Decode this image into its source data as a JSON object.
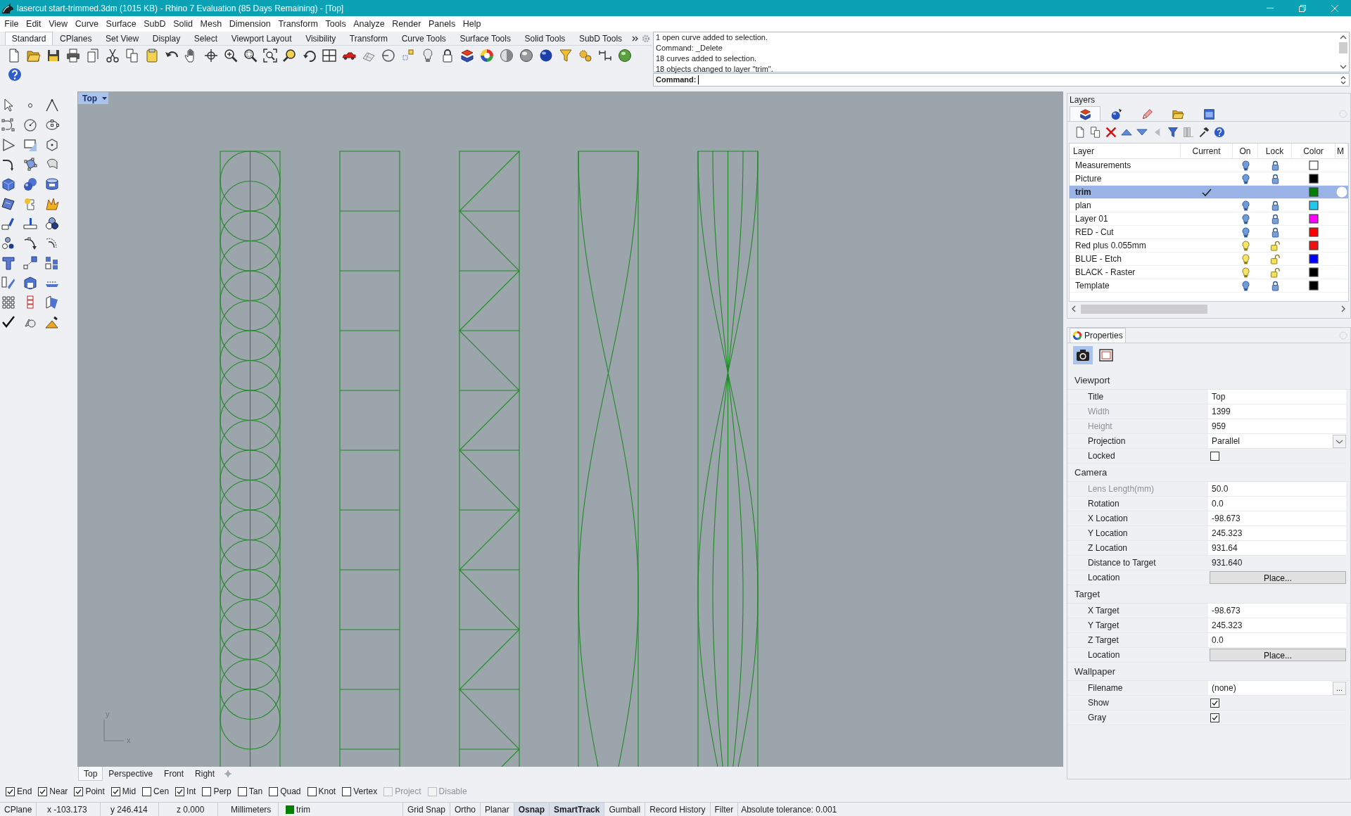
{
  "window": {
    "title": "lasercut start-trimmed.3dm (1015 KB) - Rhino 7 Evaluation (85 Days Remaining) - [Top]"
  },
  "menu": [
    "File",
    "Edit",
    "View",
    "Curve",
    "Surface",
    "SubD",
    "Solid",
    "Mesh",
    "Dimension",
    "Transform",
    "Tools",
    "Analyze",
    "Render",
    "Panels",
    "Help"
  ],
  "toolbar_tabs": [
    {
      "label": "Standard",
      "selected": true
    },
    {
      "label": "CPlanes",
      "selected": false
    },
    {
      "label": "Set View",
      "selected": false
    },
    {
      "label": "Display",
      "selected": false
    },
    {
      "label": "Select",
      "selected": false
    },
    {
      "label": "Viewport Layout",
      "selected": false
    },
    {
      "label": "Visibility",
      "selected": false
    },
    {
      "label": "Transform",
      "selected": false
    },
    {
      "label": "Curve Tools",
      "selected": false
    },
    {
      "label": "Surface Tools",
      "selected": false
    },
    {
      "label": "Solid Tools",
      "selected": false
    },
    {
      "label": "SubD Tools",
      "selected": false
    }
  ],
  "command": {
    "history": [
      "1 open curve added to selection.",
      "Command: _Delete",
      "18 curves added to selection.",
      "18 objects changed to layer \"trim\"."
    ],
    "prompt": "Command:"
  },
  "viewport": {
    "title": "Top",
    "axis_labels": {
      "y": "y",
      "x": "x"
    }
  },
  "viewport_tabs": [
    {
      "label": "Top",
      "selected": true
    },
    {
      "label": "Perspective",
      "selected": false
    },
    {
      "label": "Front",
      "selected": false
    },
    {
      "label": "Right",
      "selected": false
    }
  ],
  "layers": {
    "title": "Layers",
    "tabs": [
      {
        "kind": "layers",
        "selected": true
      },
      {
        "kind": "display",
        "selected": false
      },
      {
        "kind": "render",
        "selected": false
      },
      {
        "kind": "files",
        "selected": false
      },
      {
        "kind": "named_views",
        "selected": false
      }
    ],
    "columns": [
      "Layer",
      "Current",
      "On",
      "Lock",
      "Color",
      "M"
    ],
    "rows": [
      {
        "name": "Measurements",
        "selected": false,
        "current": false,
        "on": false,
        "locked": true,
        "color": "#ffffff"
      },
      {
        "name": "Picture",
        "selected": false,
        "current": false,
        "on": false,
        "locked": true,
        "color": "#000000"
      },
      {
        "name": "trim",
        "selected": true,
        "current": true,
        "color": "#008000"
      },
      {
        "name": "plan",
        "selected": false,
        "current": false,
        "on": false,
        "locked": true,
        "color": "#1ec8f0"
      },
      {
        "name": "Layer 01",
        "selected": false,
        "current": false,
        "on": false,
        "locked": true,
        "color": "#ff00ff"
      },
      {
        "name": "RED - Cut",
        "selected": false,
        "current": false,
        "on": false,
        "locked": true,
        "color": "#ff0000"
      },
      {
        "name": "Red plus 0.055mm",
        "selected": false,
        "current": false,
        "on": true,
        "locked": false,
        "color": "#f01010"
      },
      {
        "name": "BLUE - Etch",
        "selected": false,
        "current": false,
        "on": true,
        "locked": false,
        "color": "#0000ff"
      },
      {
        "name": "BLACK - Raster",
        "selected": false,
        "current": false,
        "on": true,
        "locked": false,
        "color": "#000000"
      },
      {
        "name": "Template",
        "selected": false,
        "current": false,
        "on": false,
        "locked": true,
        "color": "#000000"
      }
    ]
  },
  "properties": {
    "title": "Properties",
    "tabs": [
      {
        "kind": "camera",
        "selected": true
      },
      {
        "kind": "viewport",
        "selected": false
      }
    ],
    "sections": [
      {
        "title": "Viewport",
        "rows": [
          {
            "label": "Title",
            "kind": "text",
            "value": "Top",
            "disabled": false
          },
          {
            "label": "Width",
            "kind": "text",
            "value": "1399",
            "disabled": true
          },
          {
            "label": "Height",
            "kind": "text",
            "value": "959",
            "disabled": true
          },
          {
            "label": "Projection",
            "kind": "dropdown",
            "value": "Parallel",
            "disabled": false
          },
          {
            "label": "Locked",
            "kind": "checkbox",
            "checked": false,
            "disabled": false
          }
        ]
      },
      {
        "title": "Camera",
        "rows": [
          {
            "label": "Lens Length(mm)",
            "kind": "text",
            "value": "50.0",
            "disabled": true
          },
          {
            "label": "Rotation",
            "kind": "text",
            "value": "0.0",
            "disabled": false
          },
          {
            "label": "X Location",
            "kind": "text",
            "value": "-98.673",
            "disabled": false
          },
          {
            "label": "Y Location",
            "kind": "text",
            "value": "245.323",
            "disabled": false
          },
          {
            "label": "Z Location",
            "kind": "text",
            "value": "931.64",
            "disabled": false
          },
          {
            "label": "Distance to Target",
            "kind": "readonly",
            "value": "931.640",
            "disabled": false
          },
          {
            "label": "Location",
            "kind": "button",
            "value": "Place...",
            "disabled": false
          }
        ]
      },
      {
        "title": "Target",
        "rows": [
          {
            "label": "X Target",
            "kind": "text",
            "value": "-98.673",
            "disabled": false
          },
          {
            "label": "Y Target",
            "kind": "text",
            "value": "245.323",
            "disabled": false
          },
          {
            "label": "Z Target",
            "kind": "text",
            "value": "0.0",
            "disabled": false
          },
          {
            "label": "Location",
            "kind": "button",
            "value": "Place...",
            "disabled": false
          }
        ]
      },
      {
        "title": "Wallpaper",
        "rows": [
          {
            "label": "Filename",
            "kind": "file",
            "value": "(none)",
            "button": "...",
            "disabled": false
          },
          {
            "label": "Show",
            "kind": "checkbox",
            "checked": true,
            "disabled": false
          },
          {
            "label": "Gray",
            "kind": "checkbox",
            "checked": true,
            "disabled": false
          }
        ]
      }
    ]
  },
  "osnaps": [
    {
      "label": "End",
      "checked": true,
      "disabled": false
    },
    {
      "label": "Near",
      "checked": true,
      "disabled": false
    },
    {
      "label": "Point",
      "checked": true,
      "disabled": false
    },
    {
      "label": "Mid",
      "checked": true,
      "disabled": false
    },
    {
      "label": "Cen",
      "checked": false,
      "disabled": false
    },
    {
      "label": "Int",
      "checked": true,
      "disabled": false
    },
    {
      "label": "Perp",
      "checked": false,
      "disabled": false
    },
    {
      "label": "Tan",
      "checked": false,
      "disabled": false
    },
    {
      "label": "Quad",
      "checked": false,
      "disabled": false
    },
    {
      "label": "Knot",
      "checked": false,
      "disabled": false
    },
    {
      "label": "Vertex",
      "checked": false,
      "disabled": false
    },
    {
      "label": "Project",
      "checked": false,
      "disabled": true
    },
    {
      "label": "Disable",
      "checked": false,
      "disabled": true
    }
  ],
  "status_bar": {
    "cplane": "CPlane",
    "coords": [
      "x -103.173",
      "y 246.414",
      "z 0.000"
    ],
    "units": "Millimeters",
    "layer": {
      "name": "trim",
      "color": "#008000"
    },
    "toggles": [
      {
        "label": "Grid Snap",
        "on": false
      },
      {
        "label": "Ortho",
        "on": false
      },
      {
        "label": "Planar",
        "on": false
      },
      {
        "label": "Osnap",
        "on": true
      },
      {
        "label": "SmartTrack",
        "on": true
      },
      {
        "label": "Gumball",
        "on": false
      },
      {
        "label": "Record History",
        "on": false
      },
      {
        "label": "Filter",
        "on": false
      }
    ],
    "tolerance": "Absolute tolerance: 0.001"
  }
}
